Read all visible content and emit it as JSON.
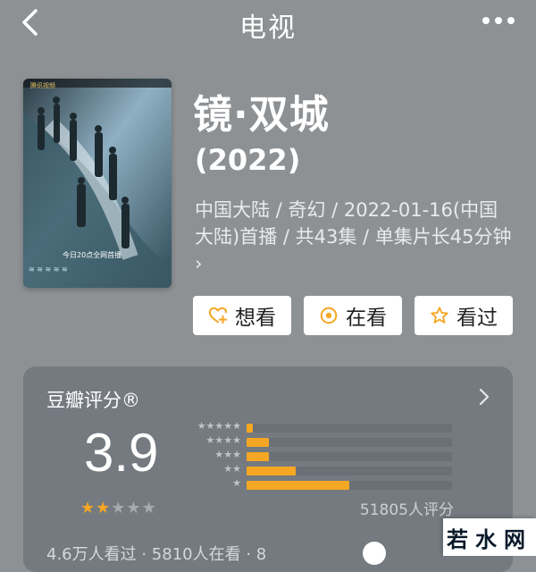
{
  "topbar": {
    "back_icon": "chevron-left-icon",
    "title": "电视",
    "more_icon": "more-horizontal-icon"
  },
  "poster": {
    "badge": "腾讯视频",
    "caption": "今日20点全网首播"
  },
  "show": {
    "title": "镜·双城",
    "year": "(2022)",
    "meta": "中国大陆 / 奇幻 / 2022-01-16(中国大陆)首播 / 共43集 / 单集片长45分钟 ›"
  },
  "actions": [
    {
      "label": "想看",
      "icon": "heart-plus-icon"
    },
    {
      "label": "在看",
      "icon": "record-circle-icon"
    },
    {
      "label": "看过",
      "icon": "star-outline-icon"
    }
  ],
  "rating": {
    "title": "豆瓣评分®",
    "score": "3.9",
    "score_stars": 2,
    "distribution": [
      {
        "stars": 5,
        "fraction": 0.03
      },
      {
        "stars": 4,
        "fraction": 0.11
      },
      {
        "stars": 3,
        "fraction": 0.11
      },
      {
        "stars": 2,
        "fraction": 0.24
      },
      {
        "stars": 1,
        "fraction": 0.5
      }
    ],
    "count": "51805人评分",
    "bottom_text": "4.6万人看过 · 5810人在看 · 8"
  },
  "watermark": "若水网",
  "colors": {
    "accent": "#f5a623",
    "background": "#8e9194",
    "card": "#747a80"
  }
}
